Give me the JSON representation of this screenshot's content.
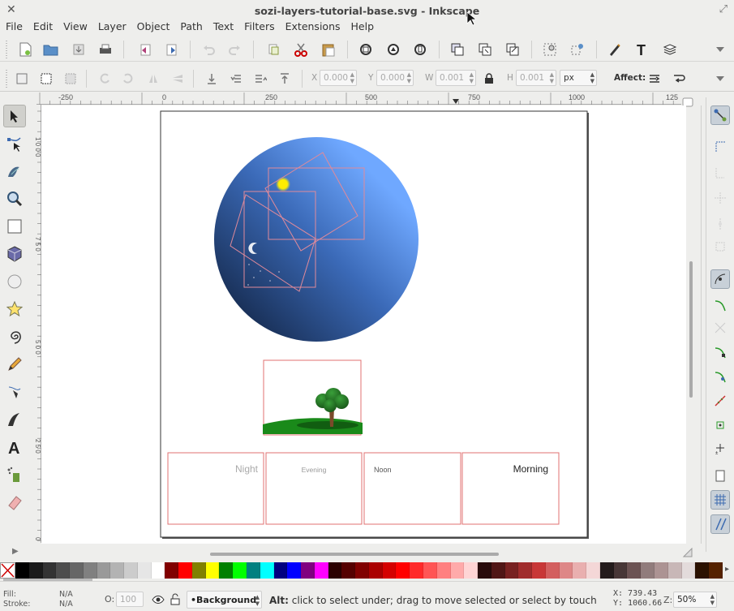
{
  "window": {
    "title": "sozi-layers-tutorial-base.svg - Inkscape",
    "close_glyph": "✕",
    "maximize_glyph": "⤢"
  },
  "menu": [
    "File",
    "Edit",
    "View",
    "Layer",
    "Object",
    "Path",
    "Text",
    "Filters",
    "Extensions",
    "Help"
  ],
  "toolbar2": {
    "x_label": "X",
    "x_value": "0.000",
    "y_label": "Y",
    "y_value": "0.000",
    "w_label": "W",
    "w_value": "0.001",
    "h_label": "H",
    "h_value": "0.001",
    "unit": "px",
    "affect_label": "Affect:"
  },
  "ruler_top": [
    "-250",
    "0",
    "250",
    "500",
    "750",
    "1000",
    "125"
  ],
  "ruler_left": [
    "1 0 0 0",
    "7 5 0",
    "5 0 0",
    "2 5 0",
    "0"
  ],
  "canvas": {
    "frame_labels": [
      "Night",
      "Evening",
      "Noon",
      "Morning"
    ],
    "colors": {
      "globe_light": "#6fa8ff",
      "globe_dark": "#0c1a33",
      "sun": "#ffee00",
      "frame_stroke": "#e07070",
      "ground": "#1a8a1a",
      "tree_leaves": "#2a7a2a",
      "tree_trunk": "#7a4a2a"
    }
  },
  "palette": [
    "#000000",
    "#1a1a1a",
    "#333333",
    "#4d4d4d",
    "#666666",
    "#808080",
    "#999999",
    "#b3b3b3",
    "#cccccc",
    "#e6e6e6",
    "#ffffff",
    "#800000",
    "#ff0000",
    "#808000",
    "#ffff00",
    "#008000",
    "#00ff00",
    "#008080",
    "#00ffff",
    "#000080",
    "#0000ff",
    "#800080",
    "#ff00ff",
    "#2b0000",
    "#550000",
    "#800000",
    "#aa0000",
    "#d40000",
    "#ff0000",
    "#ff2a2a",
    "#ff5555",
    "#ff8080",
    "#ffaaaa",
    "#ffd5d5",
    "#280b0b",
    "#501616",
    "#782121",
    "#a02c2c",
    "#c83737",
    "#d35f5f",
    "#de8787",
    "#e9afaf",
    "#f4d7d7",
    "#241c1c",
    "#483737",
    "#6c5353",
    "#917c7c",
    "#ac9393",
    "#c8b7b7",
    "#e3dbdb",
    "#2b1100",
    "#552200"
  ],
  "status": {
    "fill_label": "Fill:",
    "fill_value": "N/A",
    "stroke_label": "Stroke:",
    "stroke_value": "N/A",
    "opacity_label": "O:",
    "opacity_value": "100",
    "layer": "•Background",
    "hint_bold": "Alt:",
    "hint_text": "click to select under; drag to move selected or select by touch",
    "x_readout": "X: 739.43",
    "y_readout": "Y: 1060.66",
    "zoom_label": "Z:",
    "zoom_value": "50%"
  }
}
